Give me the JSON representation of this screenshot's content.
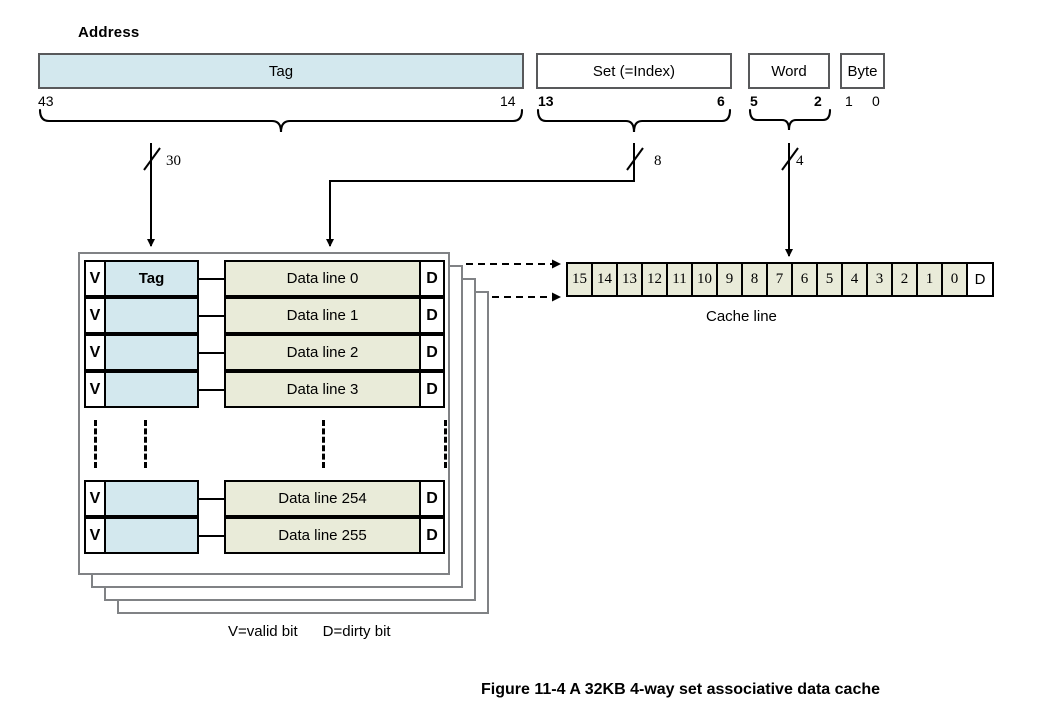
{
  "address": {
    "label": "Address",
    "fields": [
      {
        "name": "tag",
        "label": "Tag",
        "hi": "43",
        "lo": "14",
        "bold_bits": false
      },
      {
        "name": "set",
        "label": "Set (=Index)",
        "hi": "13",
        "lo": "6",
        "bold_bits": true
      },
      {
        "name": "word",
        "label": "Word",
        "hi": "5",
        "lo": "2",
        "bold_bits": true
      },
      {
        "name": "byte",
        "label": "Byte",
        "hi": "1",
        "lo": "0",
        "bold_bits": false
      }
    ]
  },
  "buses": [
    {
      "name": "tag-bus",
      "width_label": "30"
    },
    {
      "name": "set-bus",
      "width_label": "8"
    },
    {
      "name": "word-bus",
      "width_label": "4"
    }
  ],
  "cache": {
    "ways": 4,
    "valid_bit_label": "V",
    "dirty_bit_label": "D",
    "tag_column_header": "Tag",
    "rows_top": [
      {
        "data_label": "Data line 0"
      },
      {
        "data_label": "Data line 1"
      },
      {
        "data_label": "Data line 2"
      },
      {
        "data_label": "Data line 3"
      }
    ],
    "rows_bottom": [
      {
        "data_label": "Data line 254"
      },
      {
        "data_label": "Data line 255"
      }
    ]
  },
  "cache_line": {
    "label": "Cache line",
    "cells": [
      "15",
      "14",
      "13",
      "12",
      "11",
      "10",
      "9",
      "8",
      "7",
      "6",
      "5",
      "4",
      "3",
      "2",
      "1",
      "0"
    ],
    "dirty_cell": "D"
  },
  "legend": {
    "text": "V=valid bit      D=dirty bit"
  },
  "caption": {
    "text": "Figure 11-4 A 32KB 4-way set associative data cache"
  },
  "colors": {
    "tag_fill": "#d3e8ee",
    "data_fill": "#e9ebd9",
    "box_stroke": "#58595b",
    "frame_stroke": "#808285",
    "cell_stroke": "#000000"
  }
}
